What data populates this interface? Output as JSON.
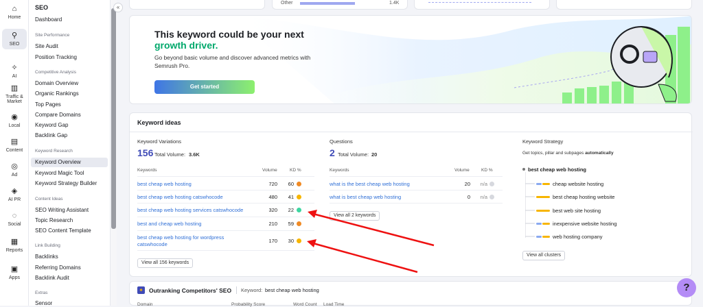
{
  "rail": [
    {
      "label": "Home",
      "icon": "home-icon",
      "glyph": "⌂"
    },
    {
      "label": "SEO",
      "icon": "seo-icon",
      "glyph": "⚲"
    },
    {
      "label": "AI",
      "icon": "ai-icon",
      "glyph": "✧"
    },
    {
      "label": "Traffic &",
      "label2": "Market",
      "icon": "traffic-icon",
      "glyph": "▥"
    },
    {
      "label": "Local",
      "icon": "local-icon",
      "glyph": "◉"
    },
    {
      "label": "Content",
      "icon": "content-icon",
      "glyph": "▤"
    },
    {
      "label": "Ad",
      "icon": "ad-icon",
      "glyph": "◎"
    },
    {
      "label": "AI PR",
      "icon": "aipr-icon",
      "glyph": "◈"
    },
    {
      "label": "Social",
      "icon": "social-icon",
      "glyph": "◌"
    },
    {
      "label": "Reports",
      "icon": "reports-icon",
      "glyph": "▦"
    },
    {
      "label": "Apps",
      "icon": "apps-icon",
      "glyph": "▣"
    }
  ],
  "nav": {
    "title": "SEO",
    "dashboard": "Dashboard",
    "sec1": "Site Performance",
    "site_audit": "Site Audit",
    "position_tracking": "Position Tracking",
    "sec2": "Competitive Analysis",
    "domain_overview": "Domain Overview",
    "organic_rankings": "Organic Rankings",
    "top_pages": "Top Pages",
    "compare_domains": "Compare Domains",
    "keyword_gap": "Keyword Gap",
    "backlink_gap": "Backlink Gap",
    "sec3": "Keyword Research",
    "keyword_overview": "Keyword Overview",
    "keyword_magic": "Keyword Magic Tool",
    "keyword_strategy": "Keyword Strategy Builder",
    "sec4": "Content Ideas",
    "seo_writing": "SEO Writing Assistant",
    "topic_research": "Topic Research",
    "seo_content": "SEO Content Template",
    "sec5": "Link Building",
    "backlinks": "Backlinks",
    "referring_domains": "Referring Domains",
    "backlink_audit": "Backlink Audit",
    "sec6": "Extras",
    "sensor": "Sensor"
  },
  "top_partial": {
    "other": "Other",
    "value": "1.4K"
  },
  "banner": {
    "line1": "This keyword could be your next",
    "line2": "growth driver.",
    "text": "Go beyond basic volume and discover advanced metrics with Semrush Pro.",
    "button": "Get started"
  },
  "keyword_ideas": {
    "title": "Keyword ideas",
    "variations": {
      "heading": "Keyword Variations",
      "count": "156",
      "total_label": "Total Volume:",
      "total": "3.6K",
      "col_keywords": "Keywords",
      "col_volume": "Volume",
      "col_kd": "KD %",
      "rows": [
        {
          "kw": "best cheap web hosting",
          "vol": "720",
          "kd": "60",
          "color": "#f08a24"
        },
        {
          "kw": "best cheap web hosting catswhocode",
          "vol": "480",
          "kd": "41",
          "color": "#f7b500"
        },
        {
          "kw": "best cheap web hosting services catswhocode",
          "vol": "320",
          "kd": "22",
          "color": "#3dd6a1"
        },
        {
          "kw": "best and cheap web hosting",
          "vol": "210",
          "kd": "59",
          "color": "#f08a24"
        },
        {
          "kw": "best cheap web hosting for wordpress",
          "kw2": "catswhocode",
          "vol": "170",
          "kd": "30",
          "color": "#f7b500"
        }
      ],
      "view_all": "View all 156 keywords"
    },
    "questions": {
      "heading": "Questions",
      "count": "2",
      "total_label": "Total Volume:",
      "total": "20",
      "col_keywords": "Keywords",
      "col_volume": "Volume",
      "col_kd": "KD %",
      "rows": [
        {
          "kw": "what is the best cheap web hosting",
          "vol": "20",
          "kd": "n/a"
        },
        {
          "kw": "what is best cheap web hosting",
          "vol": "0",
          "kd": "n/a"
        }
      ],
      "view_all": "View all 2 keywords"
    },
    "strategy": {
      "heading": "Keyword Strategy",
      "sub": "Get topics, pillar and subpages ",
      "sub_bold": "automatically",
      "root": "best cheap web hosting",
      "items": [
        "cheap website hosting",
        "best cheap hosting website",
        "best web site hosting",
        "inexpensive website hosting",
        "web hosting company"
      ],
      "view_all": "View all clusters"
    }
  },
  "bottom": {
    "title": "Outranking Competitors' SEO",
    "kw_label": "Keyword:",
    "kw": "best cheap web hosting",
    "cols": [
      "Domain",
      "Probability Score",
      "Word Count",
      "Load Time"
    ]
  },
  "help": "?"
}
